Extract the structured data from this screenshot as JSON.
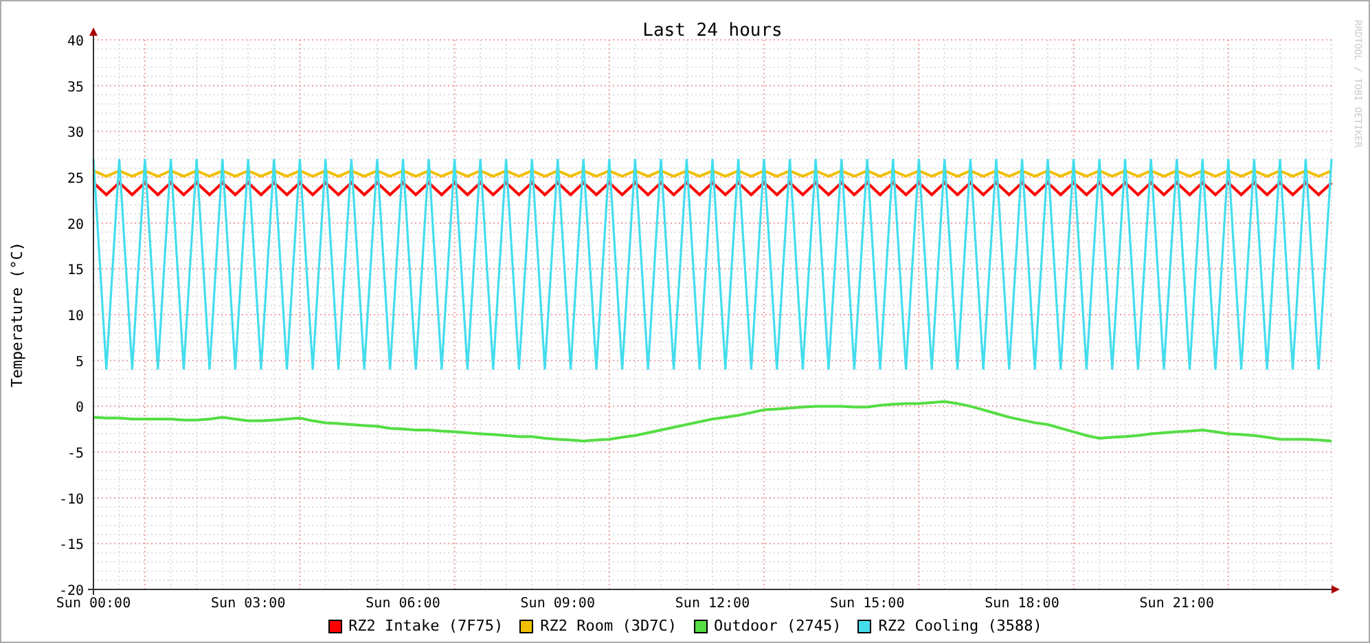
{
  "credit": "RRDTOOL / TOBI OETIKER",
  "chart_data": {
    "type": "line",
    "title": "Last 24 hours",
    "ylabel": "Temperature (°C)",
    "grid": true,
    "ylim": [
      -20,
      40
    ],
    "yticks": [
      -20,
      -15,
      -10,
      -5,
      0,
      5,
      10,
      15,
      20,
      25,
      30,
      35,
      40
    ],
    "categories": [
      "Sun 00:00",
      null,
      null,
      null,
      null,
      null,
      null,
      null,
      null,
      null,
      null,
      null,
      "Sun 03:00",
      null,
      null,
      null,
      null,
      null,
      null,
      null,
      null,
      null,
      null,
      null,
      "Sun 06:00",
      null,
      null,
      null,
      null,
      null,
      null,
      null,
      null,
      null,
      null,
      null,
      "Sun 09:00",
      null,
      null,
      null,
      null,
      null,
      null,
      null,
      null,
      null,
      null,
      null,
      "Sun 12:00",
      null,
      null,
      null,
      null,
      null,
      null,
      null,
      null,
      null,
      null,
      null,
      "Sun 15:00",
      null,
      null,
      null,
      null,
      null,
      null,
      null,
      null,
      null,
      null,
      null,
      "Sun 18:00",
      null,
      null,
      null,
      null,
      null,
      null,
      null,
      null,
      null,
      null,
      null,
      "Sun 21:00",
      null,
      null,
      null,
      null,
      null,
      null,
      null,
      null,
      null,
      null,
      null,
      null
    ],
    "series": [
      {
        "name": "RZ2 Intake (7F75)",
        "color": "#ff0000",
        "values": [
          24.4,
          23.1,
          24.4,
          23.1,
          24.4,
          23.1,
          24.4,
          23.1,
          24.4,
          23.1,
          24.4,
          23.1,
          24.4,
          23.1,
          24.4,
          23.1,
          24.4,
          23.1,
          24.4,
          23.1,
          24.4,
          23.1,
          24.4,
          23.1,
          24.4,
          23.1,
          24.4,
          23.1,
          24.4,
          23.1,
          24.4,
          23.1,
          24.4,
          23.1,
          24.4,
          23.1,
          24.4,
          23.1,
          24.4,
          23.1,
          24.4,
          23.1,
          24.4,
          23.1,
          24.4,
          23.1,
          24.4,
          23.1,
          24.4,
          23.1,
          24.4,
          23.1,
          24.4,
          23.1,
          24.4,
          23.1,
          24.4,
          23.1,
          24.4,
          23.1,
          24.4,
          23.1,
          24.4,
          23.1,
          24.4,
          23.1,
          24.4,
          23.1,
          24.4,
          23.1,
          24.4,
          23.1,
          24.4,
          23.1,
          24.4,
          23.1,
          24.4,
          23.1,
          24.4,
          23.1,
          24.4,
          23.1,
          24.4,
          23.1,
          24.4,
          23.1,
          24.4,
          23.1,
          24.4,
          23.1,
          24.4,
          23.1,
          24.4,
          23.1,
          24.4,
          23.1,
          24.4
        ]
      },
      {
        "name": "RZ2 Room (3D7C)",
        "color": "#f0c000",
        "values": [
          25.7,
          25.1,
          25.7,
          25.1,
          25.7,
          25.1,
          25.7,
          25.1,
          25.7,
          25.1,
          25.7,
          25.1,
          25.7,
          25.1,
          25.7,
          25.1,
          25.7,
          25.1,
          25.7,
          25.1,
          25.7,
          25.1,
          25.7,
          25.1,
          25.7,
          25.1,
          25.7,
          25.1,
          25.7,
          25.1,
          25.7,
          25.1,
          25.7,
          25.1,
          25.7,
          25.1,
          25.7,
          25.1,
          25.7,
          25.1,
          25.7,
          25.1,
          25.7,
          25.1,
          25.7,
          25.1,
          25.7,
          25.1,
          25.7,
          25.1,
          25.7,
          25.1,
          25.7,
          25.1,
          25.7,
          25.1,
          25.7,
          25.1,
          25.7,
          25.1,
          25.7,
          25.1,
          25.7,
          25.1,
          25.7,
          25.1,
          25.7,
          25.1,
          25.7,
          25.1,
          25.7,
          25.1,
          25.7,
          25.1,
          25.7,
          25.1,
          25.7,
          25.1,
          25.7,
          25.1,
          25.7,
          25.1,
          25.7,
          25.1,
          25.7,
          25.1,
          25.7,
          25.1,
          25.7,
          25.1,
          25.7,
          25.1,
          25.7,
          25.1,
          25.7,
          25.1,
          25.7
        ]
      },
      {
        "name": "Outdoor (2745)",
        "color": "#55dd44",
        "values": [
          -1.2,
          -1.3,
          -1.3,
          -1.4,
          -1.4,
          -1.4,
          -1.4,
          -1.5,
          -1.5,
          -1.4,
          -1.2,
          -1.4,
          -1.6,
          -1.6,
          -1.5,
          -1.4,
          -1.3,
          -1.6,
          -1.8,
          -1.9,
          -2.0,
          -2.1,
          -2.2,
          -2.4,
          -2.5,
          -2.6,
          -2.6,
          -2.7,
          -2.8,
          -2.9,
          -3.0,
          -3.1,
          -3.2,
          -3.3,
          -3.3,
          -3.5,
          -3.6,
          -3.7,
          -3.8,
          -3.7,
          -3.6,
          -3.4,
          -3.2,
          -2.9,
          -2.6,
          -2.3,
          -2.0,
          -1.7,
          -1.4,
          -1.2,
          -1.0,
          -0.7,
          -0.4,
          -0.3,
          -0.2,
          -0.1,
          0,
          0,
          0,
          -0.1,
          -0.1,
          0.1,
          0.2,
          0.3,
          0.3,
          0.4,
          0.5,
          0.3,
          0,
          -0.4,
          -0.8,
          -1.2,
          -1.5,
          -1.8,
          -2.0,
          -2.4,
          -2.8,
          -3.2,
          -3.5,
          -3.4,
          -3.3,
          -3.2,
          -3.0,
          -2.9,
          -2.8,
          -2.7,
          -2.6,
          -2.8,
          -3.0,
          -3.1,
          -3.2,
          -3.4,
          -3.6,
          -3.6,
          -3.6,
          -3.7,
          -3.8
        ]
      },
      {
        "name": "RZ2 Cooling (3588)",
        "color": "#44ddee",
        "values": [
          27,
          4,
          27,
          4,
          27,
          4,
          27,
          4,
          27,
          4,
          27,
          4,
          27,
          4,
          27,
          4,
          27,
          4,
          27,
          4,
          27,
          4,
          27,
          4,
          27,
          4,
          27,
          4,
          27,
          4,
          27,
          4,
          27,
          4,
          27,
          4,
          27,
          4,
          27,
          4,
          27,
          4,
          27,
          4,
          27,
          4,
          27,
          4,
          27,
          4,
          27,
          4,
          27,
          4,
          27,
          4,
          27,
          4,
          27,
          4,
          27,
          4,
          27,
          4,
          27,
          4,
          27,
          4,
          27,
          4,
          27,
          4,
          27,
          4,
          27,
          4,
          27,
          4,
          27,
          4,
          27,
          4,
          27,
          4,
          27,
          4,
          27,
          4,
          27,
          4,
          27,
          4,
          27,
          4,
          27,
          4,
          27
        ]
      }
    ]
  }
}
